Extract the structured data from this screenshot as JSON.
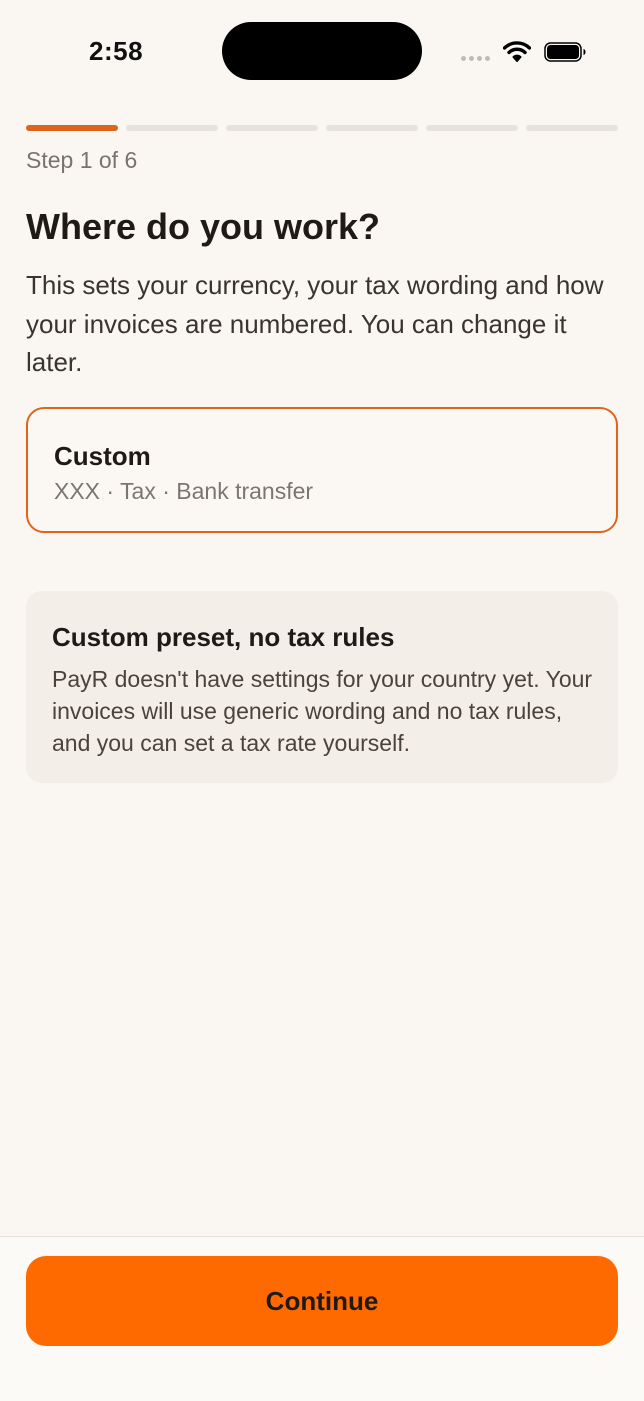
{
  "status_bar": {
    "time": "2:58",
    "icons": [
      "cellular-signal-icon",
      "wifi-icon",
      "battery-icon"
    ]
  },
  "onboarding": {
    "step_label": "Step 1 of 6",
    "current_step": 1,
    "total_steps": 6,
    "title": "Where do you work?",
    "description": "This sets your currency, your tax wording and how your invoices are numbered. You can change it later."
  },
  "preset": {
    "name": "Custom",
    "detail": "XXX · Tax · Bank transfer",
    "selected": true
  },
  "info": {
    "title": "Custom preset, no tax rules",
    "body": "PayR doesn't have settings for your country yet. Your invoices will use generic wording and no tax rules, and you can set a tax rate yourself."
  },
  "footer": {
    "continue_label": "Continue"
  },
  "colors": {
    "accent": "#E0651C",
    "button": "#FF6A00",
    "background": "#FAF7F2",
    "info_background": "#F3EEE7",
    "progress_inactive": "#E7E2DB"
  }
}
